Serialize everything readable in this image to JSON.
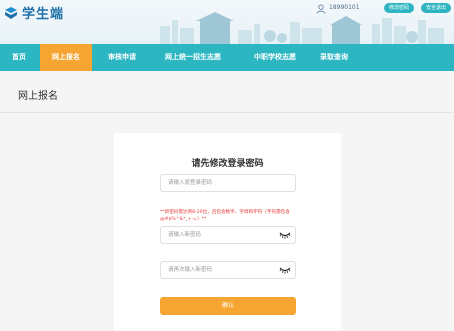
{
  "header": {
    "brand": "学生端",
    "phone": "18990101",
    "change_password_label": "修改密码",
    "logout_label": "安全退出"
  },
  "nav": {
    "items": [
      {
        "label": "首页"
      },
      {
        "label": "网上报名"
      },
      {
        "label": "审核申请"
      },
      {
        "label": "网上统一招生志愿"
      },
      {
        "label": "中职学校志愿"
      },
      {
        "label": "录取查询"
      }
    ],
    "active_index": 1
  },
  "breadcrumb": {
    "label": "网上报名"
  },
  "form": {
    "title": "请先修改登录密码",
    "old_password_placeholder": "请输入原登录密码",
    "rule_text": "**新密码需达到8-20位，且包含数字、字母和字符（字符需包含@#$%^&*_+-=）**",
    "new_password_placeholder": "请输入新密码",
    "confirm_password_placeholder": "请再次输入新密码",
    "submit_label": "确认"
  },
  "colors": {
    "nav": "#2bb6c1",
    "active": "#f6a533",
    "brand": "#1f6fa8",
    "warning": "#e53935"
  },
  "icons": {
    "logo": "logo-icon",
    "user": "user-icon",
    "eye": "eye-closed-icon"
  }
}
